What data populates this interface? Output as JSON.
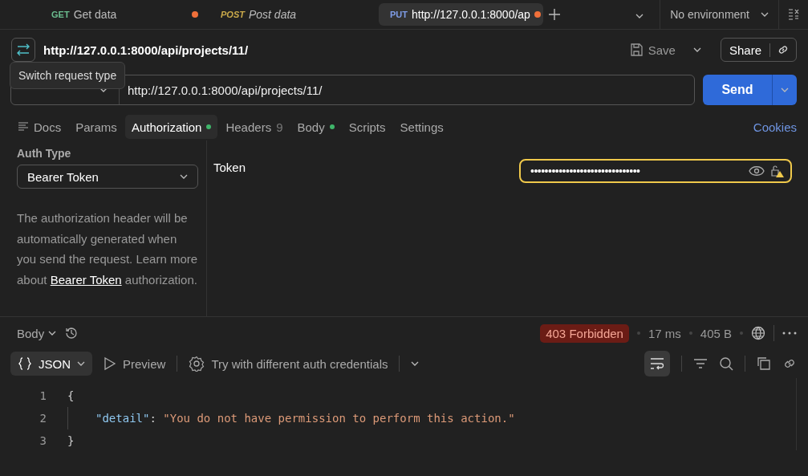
{
  "request_tabs": [
    {
      "method": "GET",
      "title": "Get data",
      "selected": false,
      "preview": false,
      "unsaved": true
    },
    {
      "method": "POST",
      "title": "Post data",
      "selected": false,
      "preview": true,
      "unsaved": false
    },
    {
      "method": "PUT",
      "title": "http://127.0.0.1:8000/ap",
      "selected": true,
      "preview": false,
      "unsaved": true
    }
  ],
  "environment": "No environment",
  "request_name": "http://127.0.0.1:8000/api/projects/11/",
  "save_label": "Save",
  "share_label": "Share",
  "tooltip": "Switch request type",
  "url": "http://127.0.0.1:8000/api/projects/11/",
  "send_label": "Send",
  "section_tabs": [
    {
      "label": "Docs",
      "selected": false,
      "dot": false
    },
    {
      "label": "Params",
      "selected": false,
      "dot": false
    },
    {
      "label": "Authorization",
      "selected": true,
      "dot": true
    },
    {
      "label": "Headers",
      "count": "9",
      "selected": false,
      "dot": false
    },
    {
      "label": "Body",
      "selected": false,
      "dot": true
    },
    {
      "label": "Scripts",
      "selected": false,
      "dot": false
    },
    {
      "label": "Settings",
      "selected": false,
      "dot": false
    }
  ],
  "cookies_link": "Cookies",
  "auth": {
    "type_label": "Auth Type",
    "type": "Bearer Token",
    "help_before": "The authorization header will be automatically generated when you send the request. Learn more about",
    "help_link": "Bearer Token",
    "help_after": "authorization.",
    "token_label": "Token",
    "token_value": "•••••••••••••••••••••••••••••••"
  },
  "response": {
    "view": "Body",
    "status": "403 Forbidden",
    "time": "17 ms",
    "size": "405 B",
    "format": "JSON",
    "preview_label": "Preview",
    "try_label": "Try with different auth credentials",
    "wrap_on": true,
    "lines": [
      {
        "number": "1",
        "tokens": [
          {
            "kind": "punct",
            "text": "{"
          }
        ]
      },
      {
        "number": "2",
        "tokens": [
          {
            "kind": "key",
            "text": "\"detail\""
          },
          {
            "kind": "punct",
            "text": ": "
          },
          {
            "kind": "string",
            "text": "\"You do not have permission to perform this action.\""
          }
        ]
      },
      {
        "number": "3",
        "tokens": [
          {
            "kind": "punct",
            "text": "}"
          }
        ]
      }
    ]
  }
}
